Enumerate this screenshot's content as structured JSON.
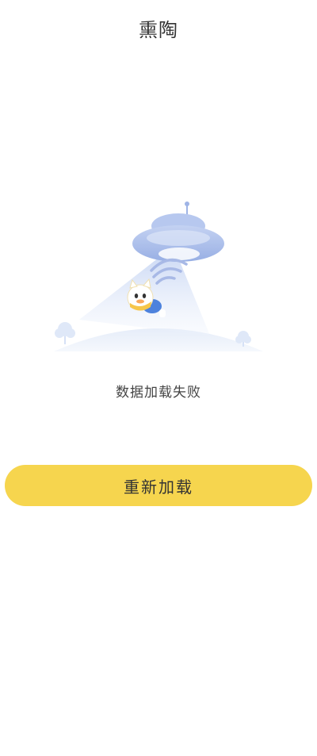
{
  "header": {
    "title": "熏陶"
  },
  "error": {
    "illustration": "ufo-abduction-error-illustration",
    "message": "数据加载失败"
  },
  "actions": {
    "reload_label": "重新加载"
  },
  "colors": {
    "accent": "#F6D54E",
    "background": "#FFFFFF",
    "text_primary": "#333333"
  }
}
